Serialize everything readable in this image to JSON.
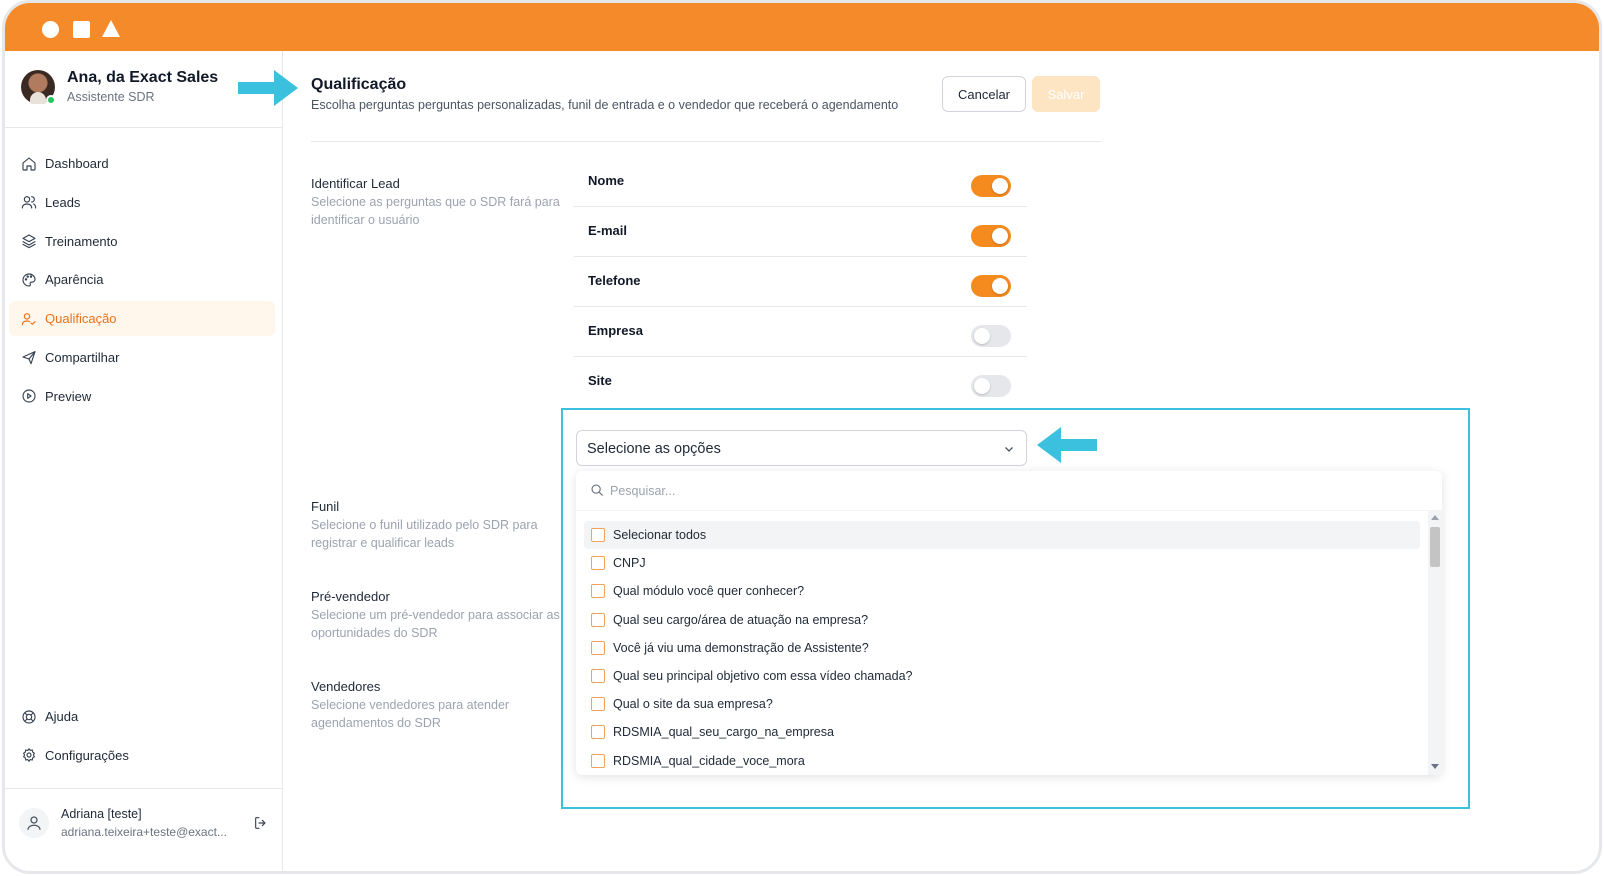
{
  "colors": {
    "titlebar": "#f58a2a",
    "accent": "#e8731b",
    "toggle_on": "#f58a1f",
    "highlight": "#3bc1dd",
    "arrow": "#3bc1dd"
  },
  "profile": {
    "name": "Ana, da Exact Sales",
    "role": "Assistente SDR",
    "status": "online"
  },
  "sidebar": {
    "items": [
      {
        "label": "Dashboard",
        "icon": "home-icon"
      },
      {
        "label": "Leads",
        "icon": "users-icon"
      },
      {
        "label": "Treinamento",
        "icon": "layers-icon"
      },
      {
        "label": "Aparência",
        "icon": "palette-icon"
      },
      {
        "label": "Qualificação",
        "icon": "user-check-icon",
        "active": true
      },
      {
        "label": "Compartilhar",
        "icon": "send-icon"
      },
      {
        "label": "Preview",
        "icon": "play-circle-icon"
      }
    ],
    "bottom_items": [
      {
        "label": "Ajuda",
        "icon": "lifebuoy-icon"
      },
      {
        "label": "Configurações",
        "icon": "gear-icon"
      }
    ]
  },
  "user": {
    "name": "Adriana [teste]",
    "email": "adriana.teixeira+teste@exact..."
  },
  "header": {
    "title": "Qualificação",
    "subtitle": "Escolha perguntas perguntas personalizadas, funil de entrada e o vendedor que receberá o agendamento",
    "cancel_label": "Cancelar",
    "save_label": "Salvar"
  },
  "sections": {
    "identificar": {
      "title": "Identificar Lead",
      "desc": "Selecione as perguntas que o SDR fará para identificar o usuário"
    },
    "funil": {
      "title": "Funil",
      "desc": "Selecione o funil utilizado pelo SDR para registrar e qualificar leads"
    },
    "prevendedor": {
      "title": "Pré-vendedor",
      "desc": "Selecione um pré-vendedor para associar as oportunidades do SDR"
    },
    "vendedores": {
      "title": "Vendedores",
      "desc": "Selecione vendedores para atender agendamentos do SDR"
    }
  },
  "toggles": [
    {
      "label": "Nome",
      "on": true
    },
    {
      "label": "E-mail",
      "on": true
    },
    {
      "label": "Telefone",
      "on": true
    },
    {
      "label": "Empresa",
      "on": false
    },
    {
      "label": "Site",
      "on": false
    }
  ],
  "select": {
    "value": "Selecione as opções",
    "search_placeholder": "Pesquisar...",
    "options": [
      "Selecionar todos",
      "CNPJ",
      "Qual módulo você quer conhecer?",
      "Qual seu cargo/área de atuação na empresa?",
      "Você já viu uma demonstração de Assistente?",
      "Qual seu principal objetivo com essa vídeo chamada?",
      "Qual o site da sua empresa?",
      "RDSMIA_qual_seu_cargo_na_empresa",
      "RDSMIA_qual_cidade_voce_mora"
    ]
  }
}
